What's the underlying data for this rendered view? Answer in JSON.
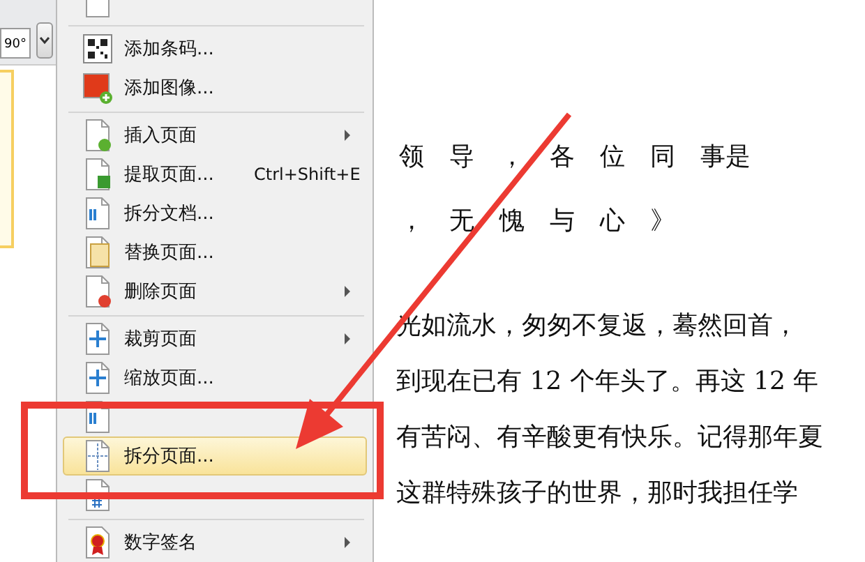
{
  "toolbar": {
    "rotate_value": "90°"
  },
  "menu": {
    "items": [
      {
        "kind": "obscured",
        "selected": false,
        "submenu": false
      },
      {
        "kind": "separator"
      },
      {
        "kind": "item",
        "label": "添加条码...",
        "selected": false,
        "submenu": false
      },
      {
        "kind": "item",
        "label": "添加图像...",
        "selected": false,
        "submenu": false
      },
      {
        "kind": "separator"
      },
      {
        "kind": "item",
        "label": "插入页面",
        "selected": false,
        "submenu": true
      },
      {
        "kind": "item",
        "label": "提取页面...",
        "shortcut": "Ctrl+Shift+E",
        "selected": false,
        "submenu": false
      },
      {
        "kind": "item",
        "label": "拆分文档...",
        "selected": false,
        "submenu": false
      },
      {
        "kind": "item",
        "label": "替换页面...",
        "selected": false,
        "submenu": false
      },
      {
        "kind": "item",
        "label": "删除页面",
        "selected": false,
        "submenu": true
      },
      {
        "kind": "separator"
      },
      {
        "kind": "item",
        "label": "裁剪页面",
        "selected": false,
        "submenu": true
      },
      {
        "kind": "item",
        "label": "缩放页面...",
        "selected": false,
        "submenu": false
      },
      {
        "kind": "obscured",
        "selected": false,
        "submenu": false
      },
      {
        "kind": "item",
        "label": "拆分页面...",
        "selected": true,
        "submenu": false
      },
      {
        "kind": "obscured",
        "selected": false,
        "submenu": false
      },
      {
        "kind": "separator"
      },
      {
        "kind": "item",
        "label": "数字签名",
        "selected": false,
        "submenu": true
      }
    ]
  },
  "document": {
    "lines": [
      {
        "kind": "spaced",
        "text": "领　导　，　各　位　同　事是"
      },
      {
        "kind": "spaced",
        "text": "，　无　愧　与　心　》"
      },
      {
        "kind": "gap"
      },
      {
        "kind": "body",
        "text": "光如流水，匆匆不复返，蓦然回首，"
      },
      {
        "kind": "body",
        "text": "到现在已有 12 个年头了。再这 12 年"
      },
      {
        "kind": "body",
        "text": "有苦闷、有辛酸更有快乐。记得那年夏"
      },
      {
        "kind": "body",
        "text": "这群特殊孩子的世界，那时我担任学"
      }
    ]
  }
}
